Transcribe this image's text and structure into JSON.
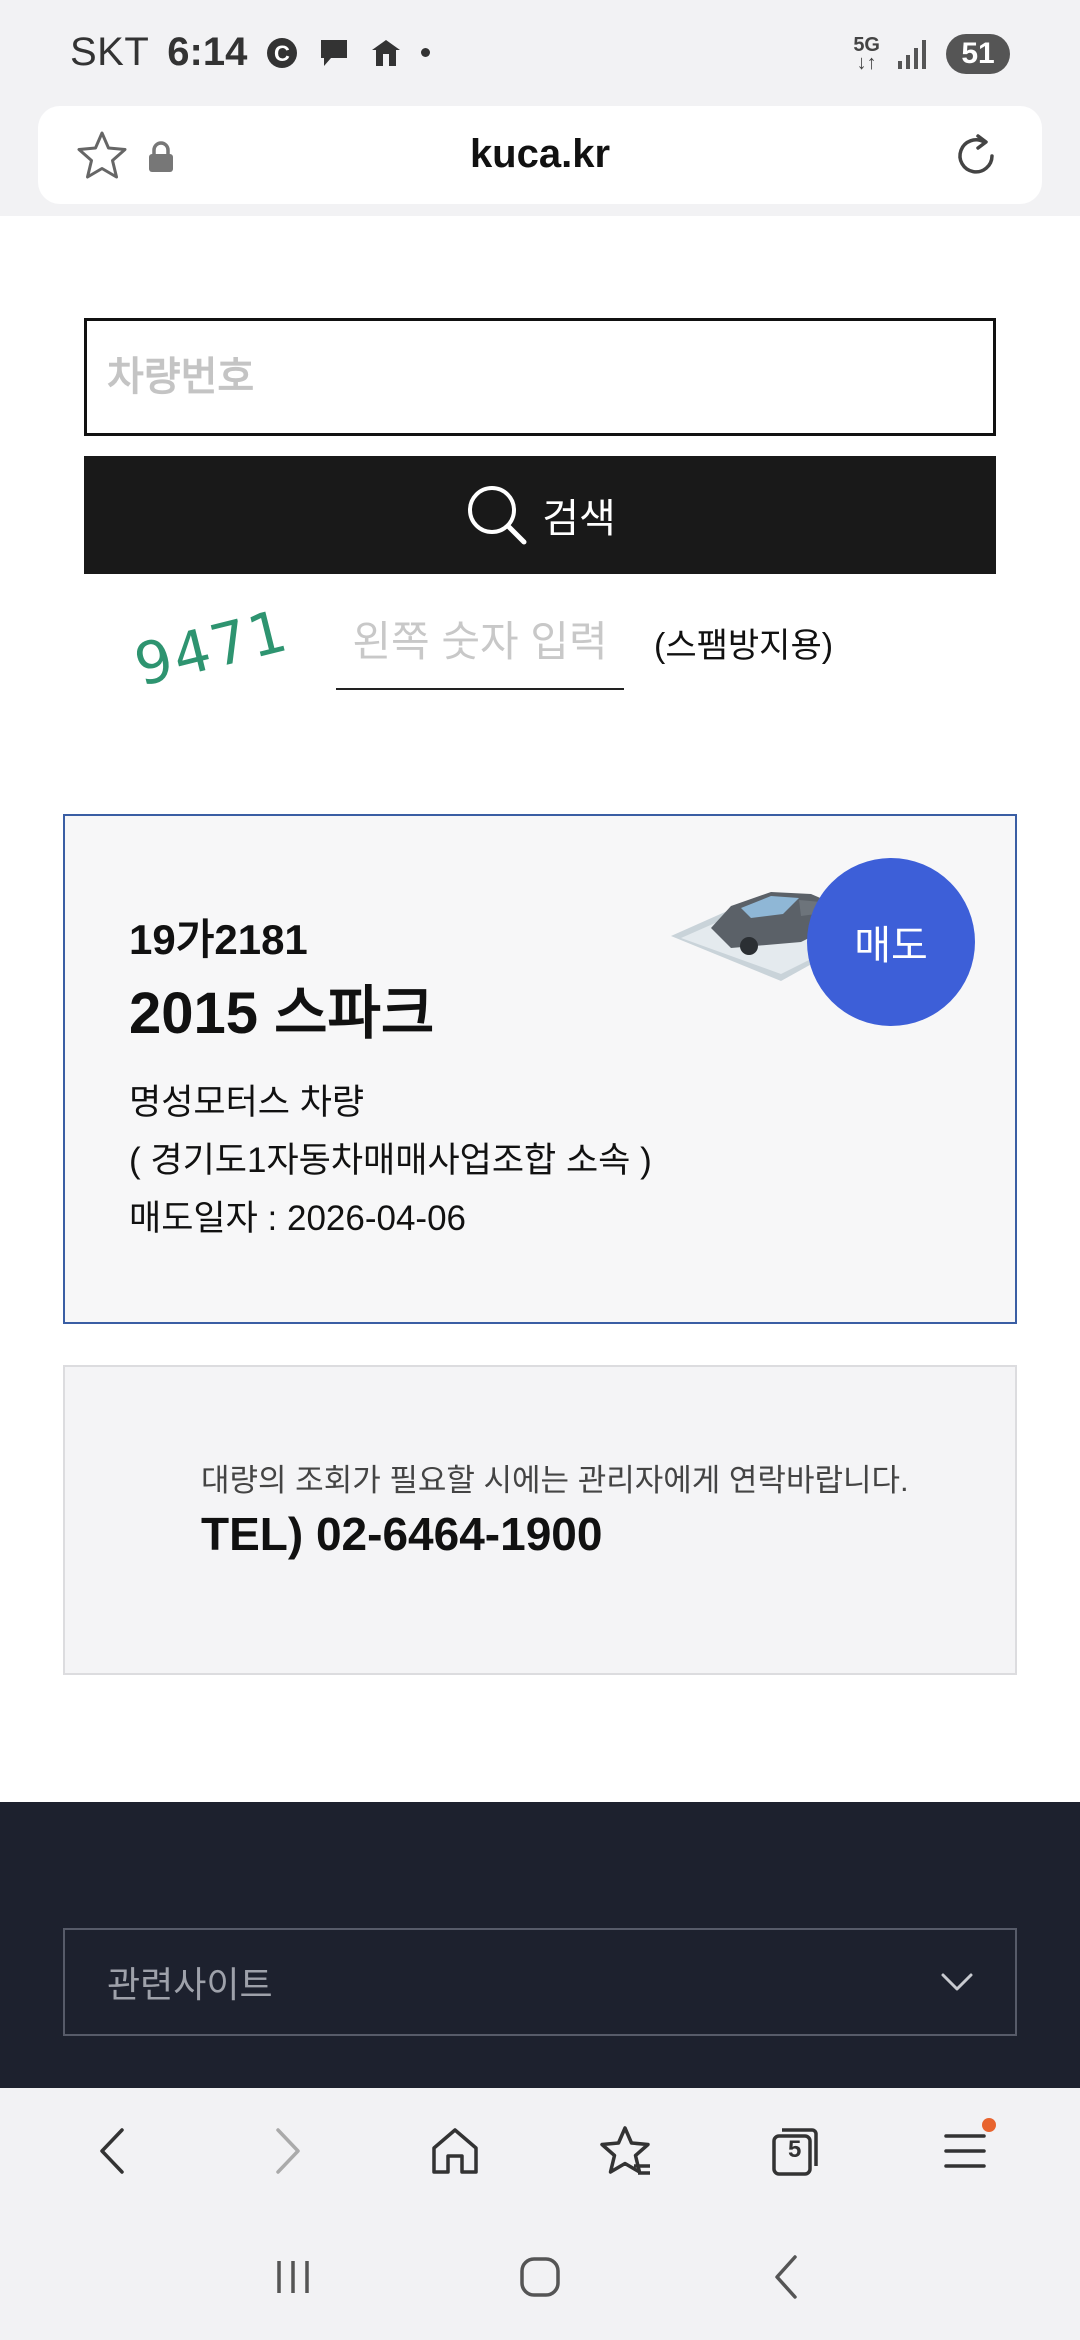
{
  "status_bar": {
    "carrier": "SKT",
    "time": "6:14",
    "network": "5G",
    "battery": "51",
    "icons": [
      "c-circle-icon",
      "chat-bubble-icon",
      "app-notification-icon",
      "dot-icon",
      "5g-icon",
      "signal-icon",
      "battery-icon"
    ]
  },
  "browser": {
    "url": "kuca.kr",
    "tab_count": "5"
  },
  "search": {
    "placeholder": "차량번호",
    "button_label": "검색"
  },
  "captcha": {
    "code": "9471",
    "placeholder": "왼쪽 숫자 입력",
    "note": "(스팸방지용)"
  },
  "result": {
    "plate": "19가2181",
    "model": "2015 스파크",
    "dealer": "명성모터스 차량",
    "association": "( 경기도1자동차매매사업조합 소속 )",
    "sale_date": "매도일자 : 2026-04-06",
    "badge": "매도",
    "badge_color": "#3d5fd8"
  },
  "contact": {
    "message": "대량의 조회가 필요할 시에는 관리자에게 연락바랍니다.",
    "tel": "TEL) 02-6464-1900"
  },
  "footer": {
    "related_sites": "관련사이트"
  }
}
